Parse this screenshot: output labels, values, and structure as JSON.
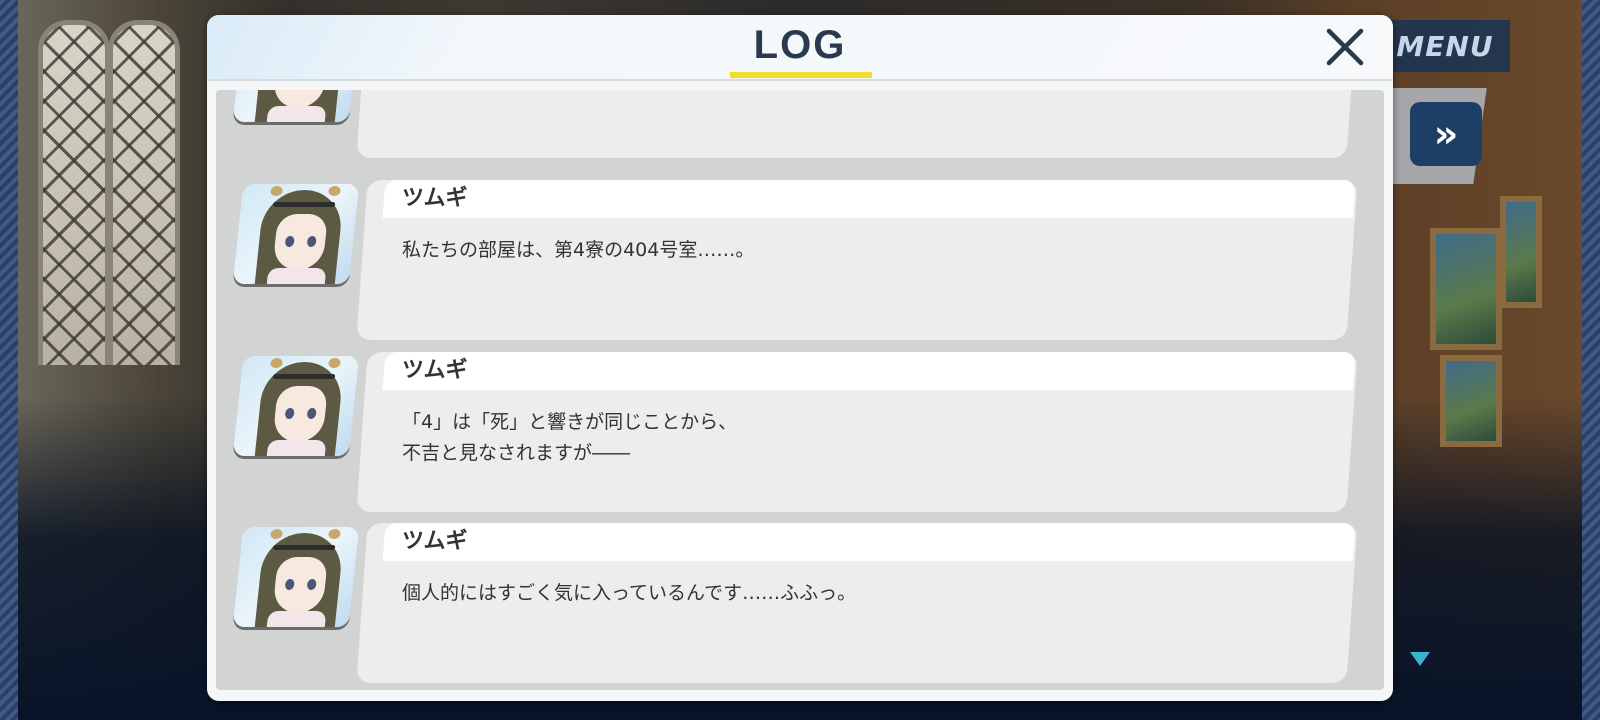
{
  "log": {
    "title": "LOG",
    "close_icon": "close-x-icon",
    "entries": [
      {
        "speaker": "",
        "lines": [],
        "portrait": "tsumugi-portrait"
      },
      {
        "speaker": "ツムギ",
        "lines": [
          "私たちの部屋は、第4寮の404号室……。"
        ],
        "portrait": "tsumugi-portrait"
      },
      {
        "speaker": "ツムギ",
        "lines": [
          "「4」は「死」と響きが同じことから、",
          "不吉と見なされますが――"
        ],
        "portrait": "tsumugi-portrait"
      },
      {
        "speaker": "ツムギ",
        "lines": [
          "個人的にはすごく気に入っているんです……ふふっ。"
        ],
        "portrait": "tsumugi-portrait"
      }
    ]
  },
  "hud": {
    "menu_label": "MENU",
    "fast_forward_glyph": "»",
    "fast_forward_icon": "fast-forward-icon",
    "next_icon": "next-page-triangle-icon"
  },
  "colors": {
    "title_underline": "#f2dd2a",
    "title_text": "#2a3a4e",
    "panel_bg": "#f4f6f8",
    "log_body_bg": "#d2d3d3",
    "bubble_bg": "#ededed",
    "ff_button": "#1d3f66"
  }
}
